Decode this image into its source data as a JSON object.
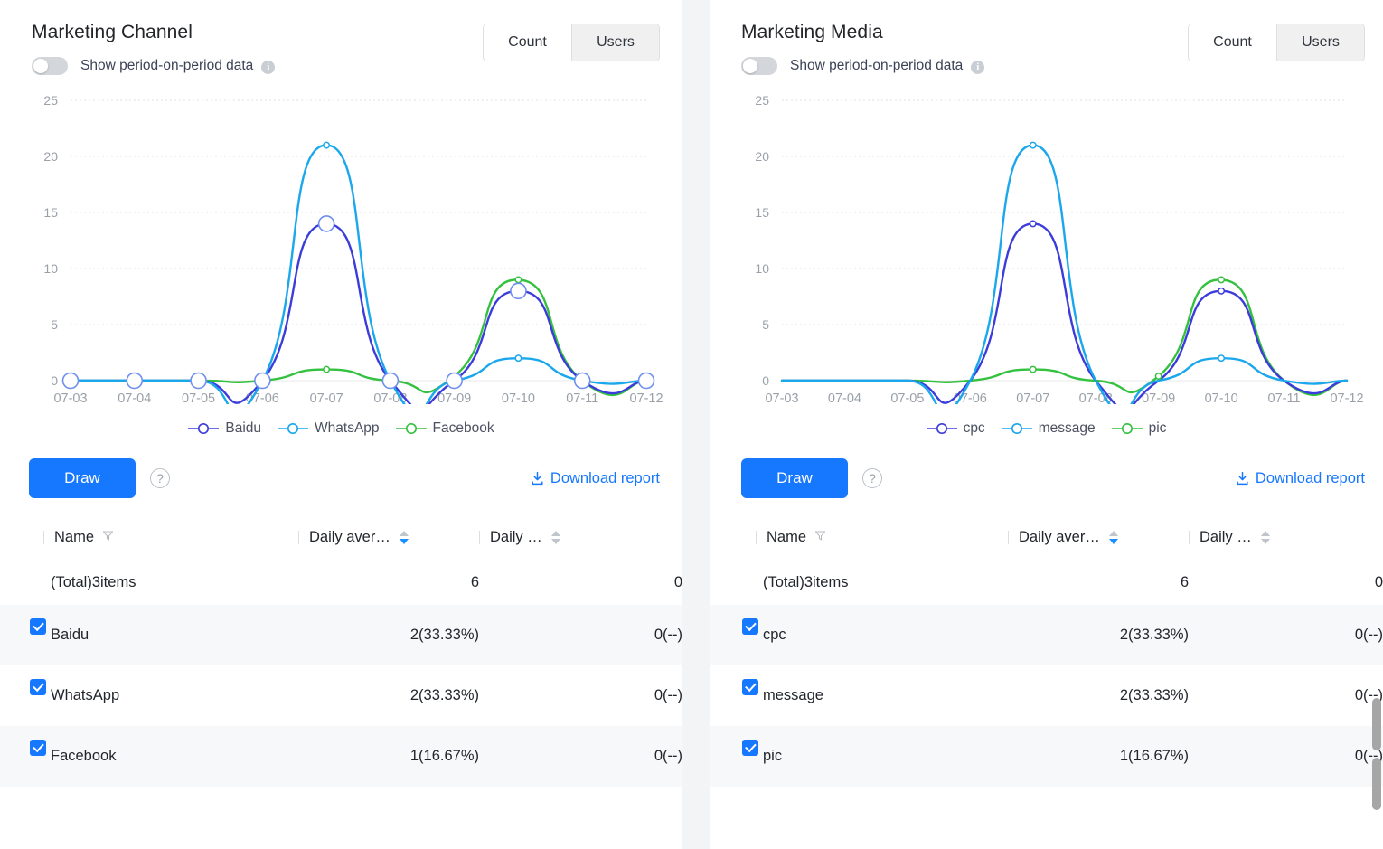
{
  "panels": [
    {
      "title": "Marketing Channel",
      "toggle_label": "Show period-on-period data",
      "toggle_on": false,
      "info_icon": "info-icon",
      "segments": [
        {
          "label": "Count",
          "active": false
        },
        {
          "label": "Users",
          "active": true
        }
      ],
      "draw_label": "Draw",
      "help_icon": "question-mark-icon",
      "download_label": "Download report",
      "download_icon": "download-icon",
      "table": {
        "columns": [
          {
            "label": "Name",
            "filter_icon": "filter-icon",
            "sort": "none"
          },
          {
            "label": "Daily aver…",
            "sort": "desc"
          },
          {
            "label": "Daily …",
            "sort": "none"
          }
        ],
        "total_row": {
          "name": "(Total)3items",
          "daily_avg": "6",
          "daily_other": "0"
        },
        "rows": [
          {
            "checked": true,
            "name": "Baidu",
            "daily_avg": "2(33.33%)",
            "daily_other": "0(--)"
          },
          {
            "checked": true,
            "name": "WhatsApp",
            "daily_avg": "2(33.33%)",
            "daily_other": "0(--)"
          },
          {
            "checked": true,
            "name": "Facebook",
            "daily_avg": "1(16.67%)",
            "daily_other": "0(--)"
          }
        ]
      },
      "chart_data": {
        "type": "line",
        "title": "Marketing Channel",
        "xlabel": "",
        "ylabel": "",
        "grid": true,
        "legend_position": "bottom",
        "ylim": [
          0,
          25
        ],
        "yticks": [
          0,
          5,
          10,
          15,
          20,
          25
        ],
        "categories": [
          "07-03",
          "07-04",
          "07-05",
          "07-06",
          "07-07",
          "07-08",
          "07-09",
          "07-10",
          "07-11",
          "07-12"
        ],
        "series": [
          {
            "name": "Baidu",
            "color": "#3c3cdb",
            "values": [
              0,
              0,
              0,
              0,
              14,
              0,
              0,
              8,
              0,
              0
            ]
          },
          {
            "name": "WhatsApp",
            "color": "#1aa7ec",
            "values": [
              0,
              0,
              0,
              0,
              21,
              0,
              0,
              2,
              0,
              0
            ]
          },
          {
            "name": "Facebook",
            "color": "#34c13f",
            "values": [
              0,
              0,
              0,
              0,
              1,
              0,
              0.4,
              9,
              0,
              0
            ]
          }
        ]
      }
    },
    {
      "title": "Marketing Media",
      "toggle_label": "Show period-on-period data",
      "toggle_on": false,
      "info_icon": "info-icon",
      "segments": [
        {
          "label": "Count",
          "active": false
        },
        {
          "label": "Users",
          "active": true
        }
      ],
      "draw_label": "Draw",
      "help_icon": "question-mark-icon",
      "download_label": "Download report",
      "download_icon": "download-icon",
      "table": {
        "columns": [
          {
            "label": "Name",
            "filter_icon": "filter-icon",
            "sort": "none"
          },
          {
            "label": "Daily aver…",
            "sort": "desc"
          },
          {
            "label": "Daily …",
            "sort": "none"
          }
        ],
        "total_row": {
          "name": "(Total)3items",
          "daily_avg": "6",
          "daily_other": "0"
        },
        "rows": [
          {
            "checked": true,
            "name": "cpc",
            "daily_avg": "2(33.33%)",
            "daily_other": "0(--)"
          },
          {
            "checked": true,
            "name": "message",
            "daily_avg": "2(33.33%)",
            "daily_other": "0(--)"
          },
          {
            "checked": true,
            "name": "pic",
            "daily_avg": "1(16.67%)",
            "daily_other": "0(--)"
          }
        ]
      },
      "chart_data": {
        "type": "line",
        "title": "Marketing Media",
        "xlabel": "",
        "ylabel": "",
        "grid": true,
        "legend_position": "bottom",
        "ylim": [
          0,
          25
        ],
        "yticks": [
          0,
          5,
          10,
          15,
          20,
          25
        ],
        "categories": [
          "07-03",
          "07-04",
          "07-05",
          "07-06",
          "07-07",
          "07-08",
          "07-09",
          "07-10",
          "07-11",
          "07-12"
        ],
        "series": [
          {
            "name": "cpc",
            "color": "#3c3cdb",
            "values": [
              0,
              0,
              0,
              0,
              14,
              0,
              0,
              8,
              0,
              0
            ]
          },
          {
            "name": "message",
            "color": "#1aa7ec",
            "values": [
              0,
              0,
              0,
              0,
              21,
              0,
              0,
              2,
              0,
              0
            ]
          },
          {
            "name": "pic",
            "color": "#34c13f",
            "values": [
              0,
              0,
              0,
              0,
              1,
              0,
              0.4,
              9,
              0,
              0
            ]
          }
        ]
      }
    }
  ],
  "colors": {
    "accent": "#1677ff",
    "series_blue": "#3c3cdb",
    "series_cyan": "#1aa7ec",
    "series_green": "#34c13f"
  },
  "scrollbar": {
    "visible": true
  }
}
